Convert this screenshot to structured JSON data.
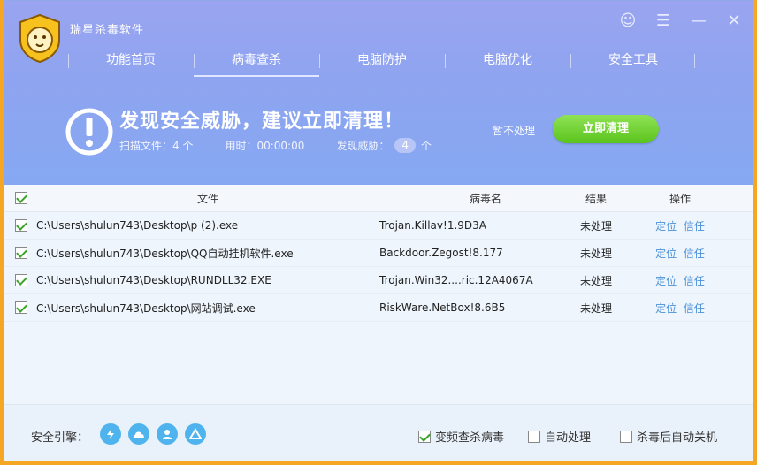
{
  "app": {
    "title": "瑞星杀毒软件"
  },
  "nav": [
    "功能首页",
    "病毒查杀",
    "电脑防护",
    "电脑优化",
    "安全工具"
  ],
  "alert": {
    "title": "发现安全威胁，建议立即清理！",
    "scan_label": "扫描文件：4 个",
    "time_label": "用时：00:00:00",
    "threat_label": "发现威胁：",
    "threat_count": "4",
    "threat_unit": "个",
    "skip": "暂不处理",
    "clean": "立即清理"
  },
  "table": {
    "headers": {
      "file": "文件",
      "virus": "病毒名",
      "result": "结果",
      "action": "操作"
    },
    "rows": [
      {
        "file": "C:\\Users\\shulun743\\Desktop\\p (2).exe",
        "virus": "Trojan.Killav!1.9D3A",
        "result": "未处理",
        "locate": "定位",
        "trust": "信任"
      },
      {
        "file": "C:\\Users\\shulun743\\Desktop\\QQ自动挂机软件.exe",
        "virus": "Backdoor.Zegost!8.177",
        "result": "未处理",
        "locate": "定位",
        "trust": "信任"
      },
      {
        "file": "C:\\Users\\shulun743\\Desktop\\RUNDLL32.EXE",
        "virus": "Trojan.Win32....ric.12A4067A",
        "result": "未处理",
        "locate": "定位",
        "trust": "信任"
      },
      {
        "file": "C:\\Users\\shulun743\\Desktop\\网站调试.exe",
        "virus": "RiskWare.NetBox!8.6B5",
        "result": "未处理",
        "locate": "定位",
        "trust": "信任"
      }
    ]
  },
  "footer": {
    "engine_label": "安全引擎：",
    "opt1": "变频查杀病毒",
    "opt2": "自动处理",
    "opt3": "杀毒后自动关机"
  }
}
